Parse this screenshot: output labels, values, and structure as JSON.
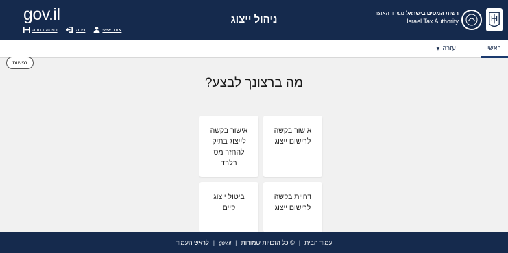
{
  "header": {
    "portal_logo": "gov.il",
    "links": {
      "login_label": "כניסה רחבה",
      "logout_label": "ניתוק",
      "personal_area_label": "אזור אישי"
    },
    "app_title": "ניהול ייצוג",
    "org_name_bold": "רשות המסים בישראל",
    "org_ministry": "משרד האוצר",
    "org_name_en": "Israel Tax Authority"
  },
  "nav": {
    "home_label": "ראשי",
    "help_label": "עזרה",
    "help_caret": "▼"
  },
  "accessibility_label": "נגישות",
  "main": {
    "heading": "מה ברצונך לבצע?",
    "cards": [
      {
        "line1": "אישור בקשה",
        "line2": "לרישום ייצוג"
      },
      {
        "line1": "אישור בקשה",
        "line2": "לייצוג בתיק",
        "line3": "להחזר מס",
        "line4": "בלבד"
      },
      {
        "line1": "דחיית בקשה",
        "line2": "לרישום ייצוג"
      },
      {
        "line1": "ביטול ייצוג",
        "line2": "קיים"
      }
    ]
  },
  "footer": {
    "home_label": "עמוד הבית",
    "rights_label": "© כל הזכויות שמורות",
    "gov_label": "gov.il",
    "top_label": "לראש העמוד",
    "separator": "|"
  },
  "colors": {
    "header_bg": "#152a4d",
    "page_bg": "#f1f1f1",
    "accent": "#1b3a6e"
  }
}
